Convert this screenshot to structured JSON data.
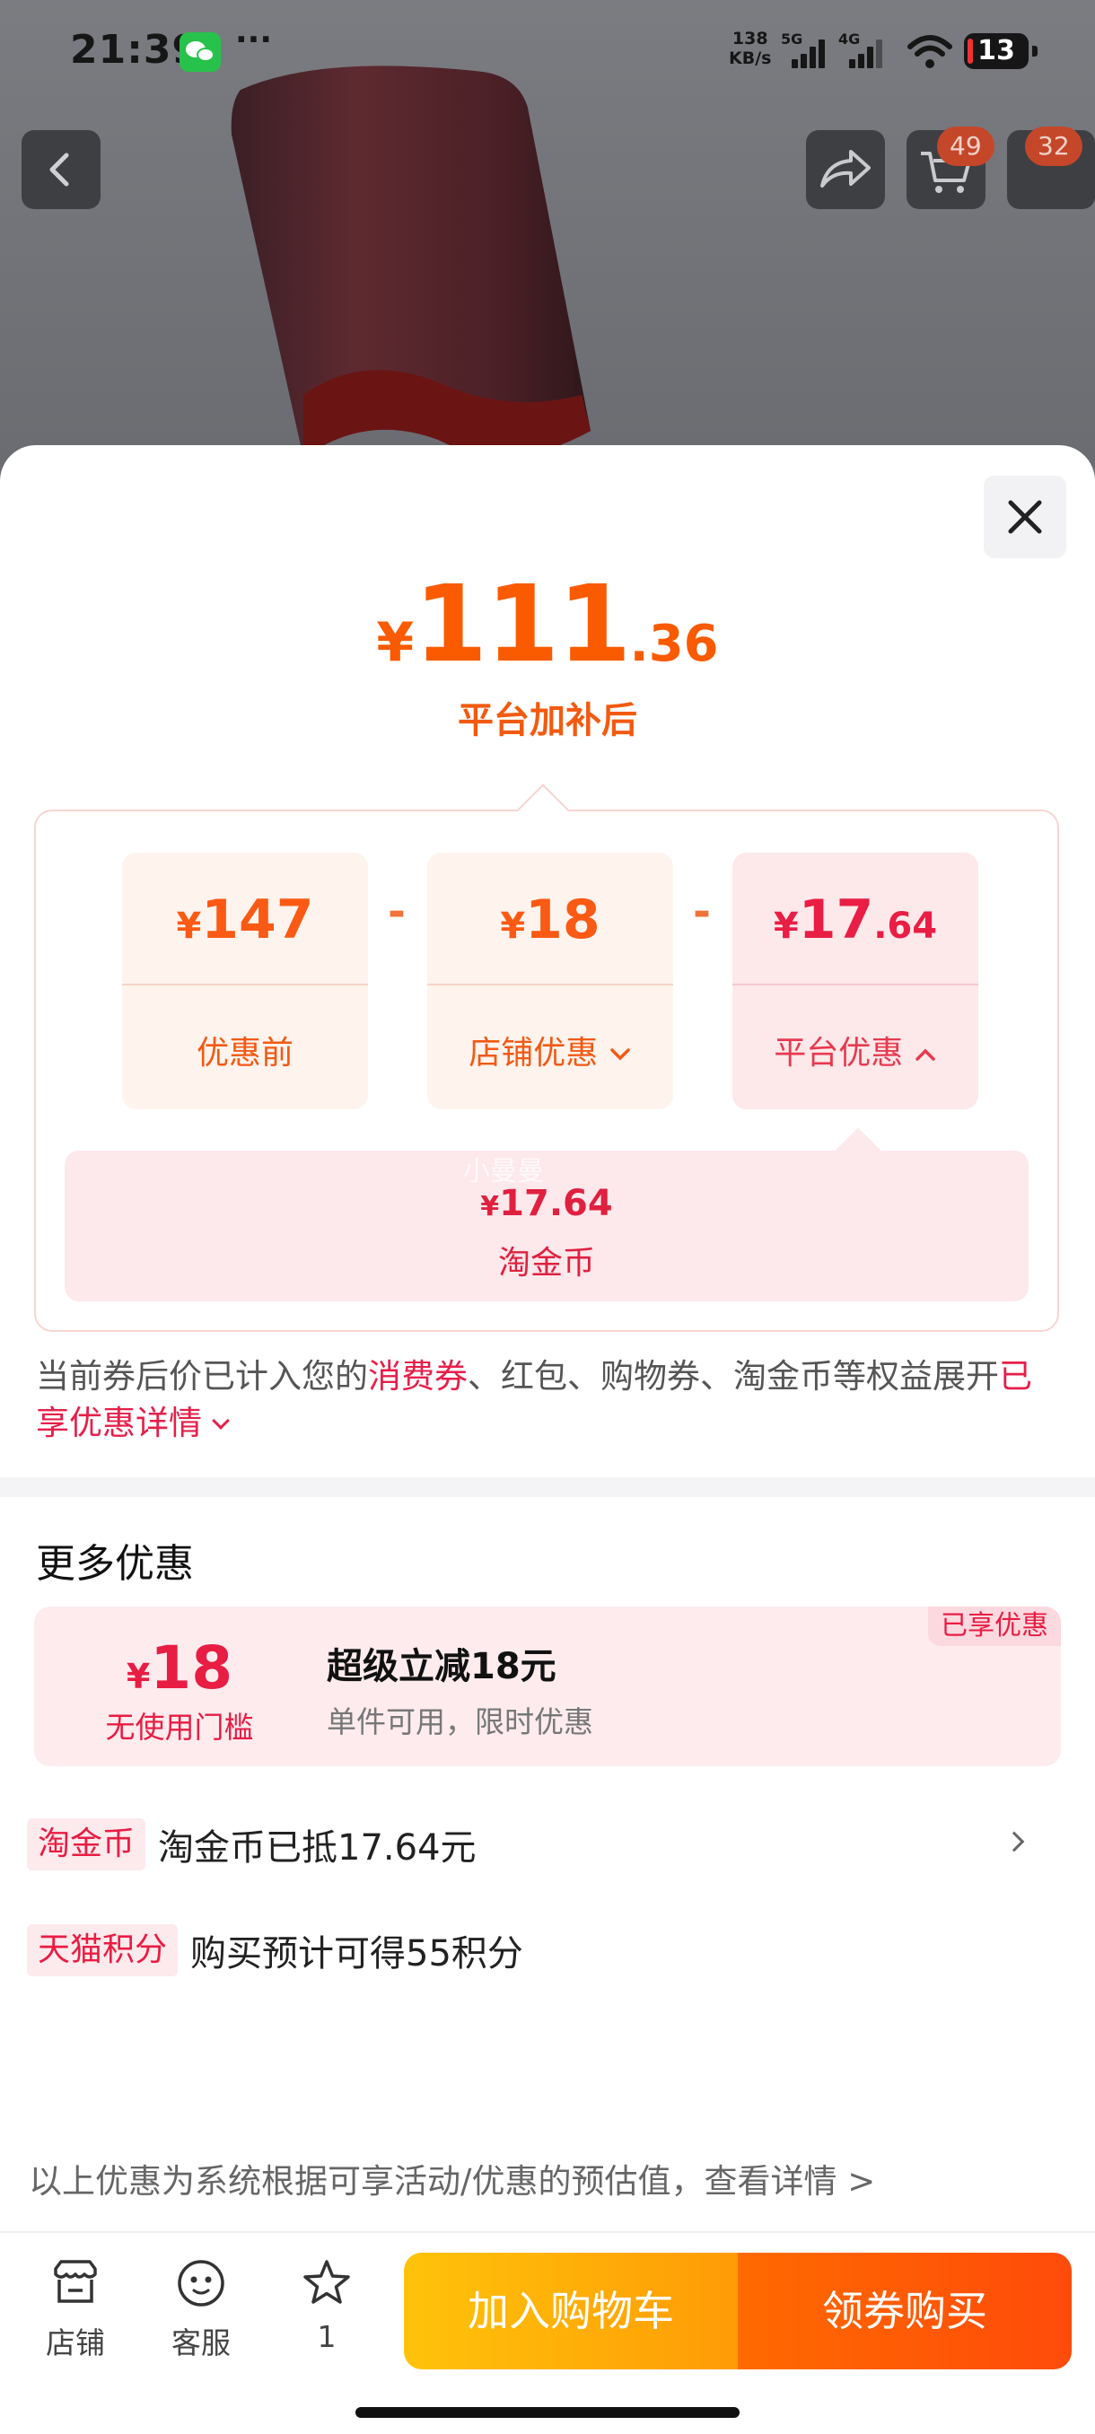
{
  "status_bar": {
    "time": "21:39",
    "more": "···",
    "net_speed_value": "138",
    "net_speed_unit": "KB/s",
    "sim1": "5G",
    "sim2": "4G",
    "battery": "13"
  },
  "header": {
    "cart_badge": "49",
    "more_badge": "32"
  },
  "price": {
    "currency": "¥",
    "integer": "111",
    "decimal": ".36",
    "caption": "平台加补后"
  },
  "breakdown": {
    "cards": [
      {
        "currency": "¥",
        "integer": "147",
        "decimal": "",
        "label": "优惠前"
      },
      {
        "currency": "¥",
        "integer": "18",
        "decimal": "",
        "label": "店铺优惠"
      },
      {
        "currency": "¥",
        "integer": "17",
        "decimal": ".64",
        "label": "平台优惠"
      }
    ],
    "operator": "-",
    "coin": {
      "currency": "¥",
      "amount": "17.64",
      "name": "淘金币"
    },
    "watermark": "小曼曼"
  },
  "note": {
    "part1": "当前券后价已计入您的",
    "highlight1": "消费券",
    "part2": "、红包、购物券、淘金币等权益展开",
    "highlight2": "已享优惠详情"
  },
  "more_offers": {
    "title": "更多优惠",
    "coupon": {
      "currency": "¥",
      "value": "18",
      "threshold": "无使用门槛",
      "title": "超级立减18元",
      "subtitle": "单件可用，限时优惠",
      "badge": "已享优惠"
    },
    "benefits": [
      {
        "tag": "淘金币",
        "text": "淘金币已抵17.64元"
      },
      {
        "tag": "天猫积分",
        "text": "购买预计可得55积分"
      }
    ],
    "disclaimer": "以上优惠为系统根据可享活动/优惠的预估值，查看详情 >"
  },
  "bottom_bar": {
    "store": "店铺",
    "service": "客服",
    "favorite_count": "1",
    "add_to_cart": "加入购物车",
    "buy": "领券购买"
  }
}
